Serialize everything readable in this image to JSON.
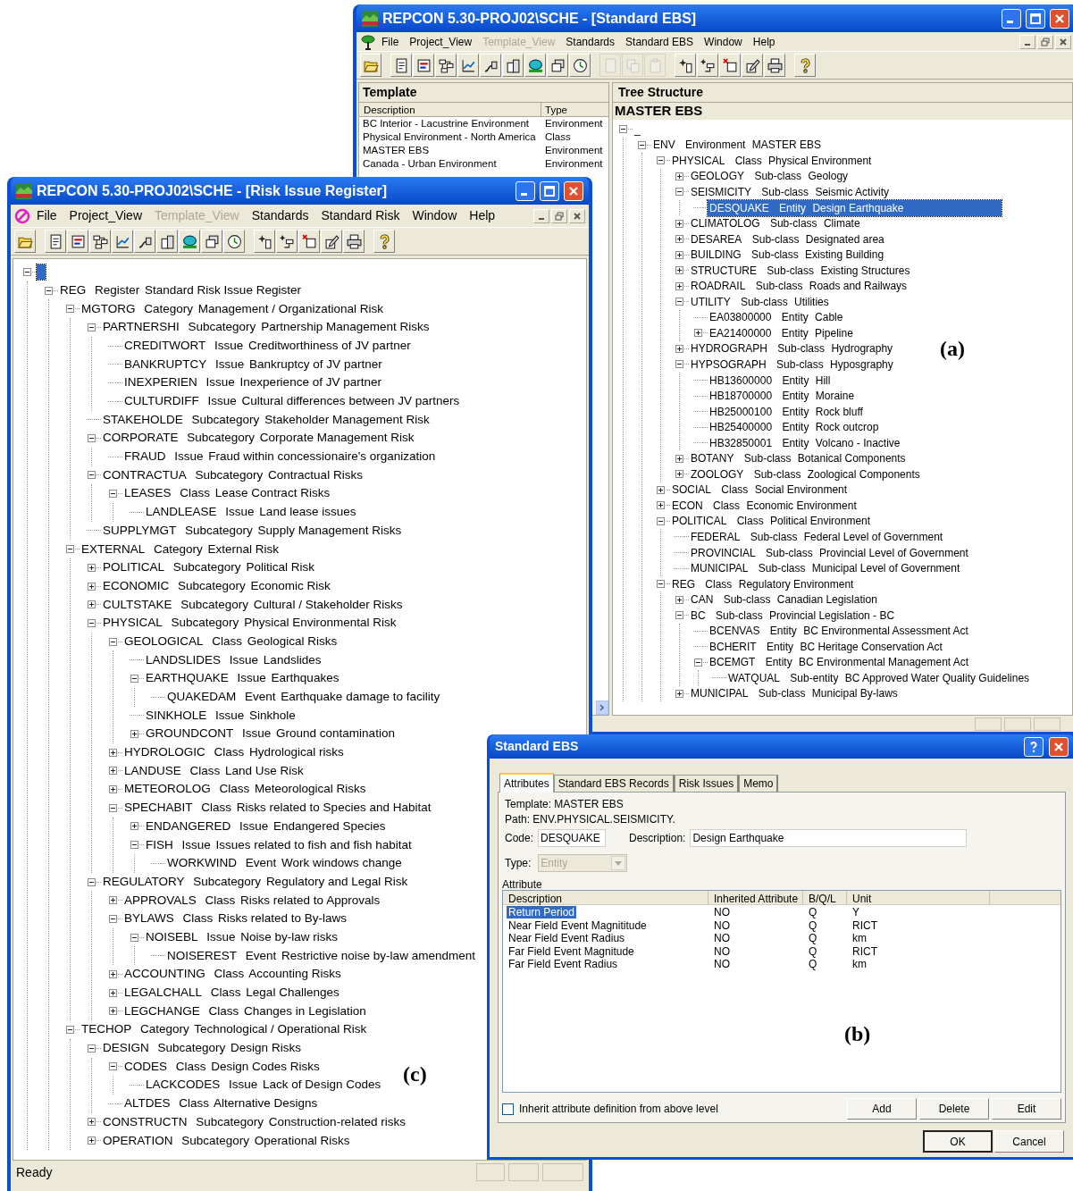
{
  "ebs_window": {
    "title": "REPCON 5.30-PROJ02\\SCHE - [Standard EBS]",
    "menu": [
      {
        "label": "File",
        "disabled": false
      },
      {
        "label": "Project_View",
        "disabled": false
      },
      {
        "label": "Template_View",
        "disabled": true
      },
      {
        "label": "Standards",
        "disabled": false
      },
      {
        "label": "Standard EBS",
        "disabled": false
      },
      {
        "label": "Window",
        "disabled": false
      },
      {
        "label": "Help",
        "disabled": false
      }
    ],
    "toolbar": [
      {
        "disabled": false
      },
      {
        "disabled": false
      },
      {
        "disabled": false
      },
      {
        "disabled": false
      },
      {
        "disabled": false
      },
      {
        "disabled": false
      },
      {
        "disabled": false
      },
      {
        "disabled": false
      },
      {
        "disabled": false
      },
      {
        "disabled": false
      },
      {
        "disabled": true
      },
      {
        "disabled": true
      },
      {
        "disabled": true
      },
      {
        "disabled": false
      },
      {
        "disabled": false
      },
      {
        "disabled": false
      },
      {
        "disabled": false
      },
      {
        "disabled": false
      },
      {
        "disabled": false
      }
    ],
    "template_pane": {
      "title": "Template",
      "columns": [
        "Description",
        "Type"
      ],
      "rows": [
        [
          "BC Interior - Lacustrine Environment",
          "Environment"
        ],
        [
          "Physical Environment - North America",
          "Class"
        ],
        [
          "MASTER EBS",
          "Environment"
        ],
        [
          "Canada - Urban Environment",
          "Environment"
        ]
      ]
    },
    "tree_pane": {
      "title": "Tree Structure",
      "template_name": "MASTER EBS",
      "root": {
        "label": "_",
        "expanded": true,
        "selected": false,
        "children": [
          {
            "code": "ENV",
            "type": "Environment",
            "description": "MASTER EBS",
            "expanded": true,
            "selected": false,
            "children": [
              {
                "code": "PHYSICAL",
                "type": "Class",
                "description": "Physical Environment",
                "expanded": true,
                "selected": false,
                "children": [
                  {
                    "code": "GEOLOGY",
                    "type": "Sub-class",
                    "description": "Geology",
                    "expanded": false,
                    "selected": false
                  },
                  {
                    "code": "SEISMICITY",
                    "type": "Sub-class",
                    "description": "Seismic Activity",
                    "expanded": true,
                    "selected": false,
                    "children": [
                      {
                        "code": "DESQUAKE",
                        "type": "Entity",
                        "description": "Design Earthquake",
                        "selected": true
                      }
                    ]
                  },
                  {
                    "code": "CLIMATOLOG",
                    "type": "Sub-class",
                    "description": "Climate",
                    "expanded": false,
                    "selected": false
                  },
                  {
                    "code": "DESAREA",
                    "type": "Sub-class",
                    "description": "Designated area",
                    "expanded": false,
                    "selected": false
                  },
                  {
                    "code": "BUILDING",
                    "type": "Sub-class",
                    "description": "Existing Building",
                    "expanded": false,
                    "selected": false
                  },
                  {
                    "code": "STRUCTURE",
                    "type": "Sub-class",
                    "description": "Existing Structures",
                    "expanded": false,
                    "selected": false
                  },
                  {
                    "code": "ROADRAIL",
                    "type": "Sub-class",
                    "description": "Roads and Railways",
                    "expanded": false,
                    "selected": false
                  },
                  {
                    "code": "UTILITY",
                    "type": "Sub-class",
                    "description": "Utilities",
                    "expanded": true,
                    "selected": false,
                    "children": [
                      {
                        "code": "EA03800000",
                        "type": "Entity",
                        "description": "Cable",
                        "selected": false
                      },
                      {
                        "code": "EA21400000",
                        "type": "Entity",
                        "description": "Pipeline",
                        "expanded": false,
                        "selected": false
                      }
                    ]
                  },
                  {
                    "code": "HYDROGRAPH",
                    "type": "Sub-class",
                    "description": "Hydrography",
                    "expanded": false,
                    "selected": false
                  },
                  {
                    "code": "HYPSOGRAPH",
                    "type": "Sub-class",
                    "description": "Hyposgraphy",
                    "expanded": true,
                    "selected": false,
                    "children": [
                      {
                        "code": "HB13600000",
                        "type": "Entity",
                        "description": "Hill",
                        "selected": false
                      },
                      {
                        "code": "HB18700000",
                        "type": "Entity",
                        "description": "Moraine",
                        "selected": false
                      },
                      {
                        "code": "HB25000100",
                        "type": "Entity",
                        "description": "Rock bluff",
                        "selected": false
                      },
                      {
                        "code": "HB25400000",
                        "type": "Entity",
                        "description": "Rock outcrop",
                        "selected": false
                      },
                      {
                        "code": "HB32850001",
                        "type": "Entity",
                        "description": "Volcano - Inactive",
                        "selected": false
                      }
                    ]
                  },
                  {
                    "code": "BOTANY",
                    "type": "Sub-class",
                    "description": "Botanical Components",
                    "expanded": false,
                    "selected": false
                  },
                  {
                    "code": "ZOOLOGY",
                    "type": "Sub-class",
                    "description": "Zoological Components",
                    "expanded": false,
                    "selected": false
                  }
                ]
              },
              {
                "code": "SOCIAL",
                "type": "Class",
                "description": "Social Environment",
                "expanded": false,
                "selected": false
              },
              {
                "code": "ECON",
                "type": "Class",
                "description": "Economic Environment",
                "expanded": false,
                "selected": false
              },
              {
                "code": "POLITICAL",
                "type": "Class",
                "description": "Political Environment",
                "expanded": true,
                "selected": false,
                "children": [
                  {
                    "code": "FEDERAL",
                    "type": "Sub-class",
                    "description": "Federal Level of Government",
                    "selected": false
                  },
                  {
                    "code": "PROVINCIAL",
                    "type": "Sub-class",
                    "description": "Provincial Level of Government",
                    "selected": false
                  },
                  {
                    "code": "MUNICIPAL",
                    "type": "Sub-class",
                    "description": "Municipal Level of Government",
                    "selected": false
                  }
                ]
              },
              {
                "code": "REG",
                "type": "Class",
                "description": "Regulatory Environment",
                "expanded": true,
                "selected": false,
                "children": [
                  {
                    "code": "CAN",
                    "type": "Sub-class",
                    "description": "Canadian Legislation",
                    "expanded": false,
                    "selected": false
                  },
                  {
                    "code": "BC",
                    "type": "Sub-class",
                    "description": "Provincial Legislation - BC",
                    "expanded": true,
                    "selected": false,
                    "children": [
                      {
                        "code": "BCENVAS",
                        "type": "Entity",
                        "description": "BC Environmental Assessment Act",
                        "selected": false
                      },
                      {
                        "code": "BCHERIT",
                        "type": "Entity",
                        "description": "BC Heritage Conservation Act",
                        "selected": false
                      },
                      {
                        "code": "BCEMGT",
                        "type": "Entity",
                        "description": "BC Environmental Management Act",
                        "expanded": true,
                        "selected": false,
                        "children": [
                          {
                            "code": "WATQUAL",
                            "type": "Sub-entity",
                            "description": "BC Approved Water Quality Guidelines",
                            "selected": false
                          }
                        ]
                      }
                    ]
                  },
                  {
                    "code": "MUNICIPAL",
                    "type": "Sub-class",
                    "description": "Municipal By-laws",
                    "expanded": false,
                    "selected": false
                  }
                ]
              }
            ]
          }
        ]
      }
    },
    "panel_label": "(a)"
  },
  "risk_window": {
    "title": "REPCON 5.30-PROJ02\\SCHE - [Risk Issue Register]",
    "menu": [
      {
        "label": "File",
        "disabled": false
      },
      {
        "label": "Project_View",
        "disabled": false
      },
      {
        "label": "Template_View",
        "disabled": true
      },
      {
        "label": "Standards",
        "disabled": false
      },
      {
        "label": "Standard Risk",
        "disabled": false
      },
      {
        "label": "Window",
        "disabled": false
      },
      {
        "label": "Help",
        "disabled": false
      }
    ],
    "tree": {
      "expanded": true,
      "selected": true,
      "children": [
        {
          "code": "REG",
          "type": "Register",
          "description": "Standard Risk Issue Register",
          "expanded": true,
          "selected": false,
          "children": [
            {
              "code": "MGTORG",
              "type": "Category",
              "description": "Management / Organizational Risk",
              "expanded": true,
              "selected": false,
              "children": [
                {
                  "code": "PARTNERSHI",
                  "type": "Subcategory",
                  "description": "Partnership Management Risks",
                  "expanded": true,
                  "selected": false,
                  "children": [
                    {
                      "code": "CREDITWORT",
                      "type": "Issue",
                      "description": "Creditworthiness of JV partner",
                      "selected": false
                    },
                    {
                      "code": "BANKRUPTCY",
                      "type": "Issue",
                      "description": "Bankruptcy of JV partner",
                      "selected": false
                    },
                    {
                      "code": "INEXPERIEN",
                      "type": "Issue",
                      "description": "Inexperience of JV partner",
                      "selected": false
                    },
                    {
                      "code": "CULTURDIFF",
                      "type": "Issue",
                      "description": "Cultural differences between JV partners",
                      "selected": false
                    }
                  ]
                },
                {
                  "code": "STAKEHOLDE",
                  "type": "Subcategory",
                  "description": "Stakeholder Management Risk",
                  "selected": false
                },
                {
                  "code": "CORPORATE",
                  "type": "Subcategory",
                  "description": "Corporate Management Risk",
                  "expanded": true,
                  "selected": false,
                  "children": [
                    {
                      "code": "FRAUD",
                      "type": "Issue",
                      "description": "Fraud within concessionaire's organization",
                      "selected": false
                    }
                  ]
                },
                {
                  "code": "CONTRACTUA",
                  "type": "Subcategory",
                  "description": "Contractual Risks",
                  "expanded": true,
                  "selected": false,
                  "children": [
                    {
                      "code": "LEASES",
                      "type": "Class",
                      "description": "Lease Contract Risks",
                      "expanded": true,
                      "selected": false,
                      "children": [
                        {
                          "code": "LANDLEASE",
                          "type": "Issue",
                          "description": "Land lease issues",
                          "selected": false
                        }
                      ]
                    }
                  ]
                },
                {
                  "code": "SUPPLYMGT",
                  "type": "Subcategory",
                  "description": "Supply Management Risks",
                  "selected": false
                }
              ]
            },
            {
              "code": "EXTERNAL",
              "type": "Category",
              "description": "External Risk",
              "expanded": true,
              "selected": false,
              "children": [
                {
                  "code": "POLITICAL",
                  "type": "Subcategory",
                  "description": "Political Risk",
                  "expanded": false,
                  "selected": false
                },
                {
                  "code": "ECONOMIC",
                  "type": "Subcategory",
                  "description": "Economic Risk",
                  "expanded": false,
                  "selected": false
                },
                {
                  "code": "CULTSTAKE",
                  "type": "Subcategory",
                  "description": "Cultural / Stakeholder Risks",
                  "expanded": false,
                  "selected": false
                },
                {
                  "code": "PHYSICAL",
                  "type": "Subcategory",
                  "description": "Physical Environmental Risk",
                  "expanded": true,
                  "selected": false,
                  "children": [
                    {
                      "code": "GEOLOGICAL",
                      "type": "Class",
                      "description": "Geological Risks",
                      "expanded": true,
                      "selected": false,
                      "children": [
                        {
                          "code": "LANDSLIDES",
                          "type": "Issue",
                          "description": "Landslides",
                          "selected": false
                        },
                        {
                          "code": "EARTHQUAKE",
                          "type": "Issue",
                          "description": "Earthquakes",
                          "expanded": true,
                          "selected": false,
                          "children": [
                            {
                              "code": "QUAKEDAM",
                              "type": "Event",
                              "description": "Earthquake damage to facility",
                              "selected": false
                            }
                          ]
                        },
                        {
                          "code": "SINKHOLE",
                          "type": "Issue",
                          "description": "Sinkhole",
                          "selected": false
                        },
                        {
                          "code": "GROUNDCONT",
                          "type": "Issue",
                          "description": "Ground contamination",
                          "expanded": false,
                          "selected": false
                        }
                      ]
                    },
                    {
                      "code": "HYDROLOGIC",
                      "type": "Class",
                      "description": "Hydrological risks",
                      "expanded": false,
                      "selected": false
                    },
                    {
                      "code": "LANDUSE",
                      "type": "Class",
                      "description": "Land Use Risk",
                      "expanded": false,
                      "selected": false
                    },
                    {
                      "code": "METEOROLOG",
                      "type": "Class",
                      "description": "Meteorological Risks",
                      "expanded": false,
                      "selected": false
                    },
                    {
                      "code": "SPECHABIT",
                      "type": "Class",
                      "description": "Risks related to Species and Habitat",
                      "expanded": true,
                      "selected": false,
                      "children": [
                        {
                          "code": "ENDANGERED",
                          "type": "Issue",
                          "description": "Endangered Species",
                          "expanded": false,
                          "selected": false
                        },
                        {
                          "code": "FISH",
                          "type": "Issue",
                          "description": "Issues related to fish and fish habitat",
                          "expanded": true,
                          "selected": false,
                          "children": [
                            {
                              "code": "WORKWIND",
                              "type": "Event",
                              "description": "Work windows change",
                              "selected": false
                            }
                          ]
                        }
                      ]
                    }
                  ]
                },
                {
                  "code": "REGULATORY",
                  "type": "Subcategory",
                  "description": "Regulatory and Legal Risk",
                  "expanded": true,
                  "selected": false,
                  "children": [
                    {
                      "code": "APPROVALS",
                      "type": "Class",
                      "description": "Risks related to Approvals",
                      "expanded": false,
                      "selected": false
                    },
                    {
                      "code": "BYLAWS",
                      "type": "Class",
                      "description": "Risks related to By-laws",
                      "expanded": true,
                      "selected": false,
                      "children": [
                        {
                          "code": "NOISEBL",
                          "type": "Issue",
                          "description": "Noise by-law risks",
                          "expanded": true,
                          "selected": false,
                          "children": [
                            {
                              "code": "NOISEREST",
                              "type": "Event",
                              "description": "Restrictive noise by-law amendment",
                              "selected": false
                            }
                          ]
                        }
                      ]
                    },
                    {
                      "code": "ACCOUNTING",
                      "type": "Class",
                      "description": "Accounting Risks",
                      "expanded": false,
                      "selected": false
                    },
                    {
                      "code": "LEGALCHALL",
                      "type": "Class",
                      "description": "Legal Challenges",
                      "expanded": false,
                      "selected": false
                    },
                    {
                      "code": "LEGCHANGE",
                      "type": "Class",
                      "description": "Changes in Legislation",
                      "expanded": false,
                      "selected": false
                    }
                  ]
                }
              ]
            },
            {
              "code": "TECHOP",
              "type": "Category",
              "description": "Technological / Operational Risk",
              "expanded": true,
              "selected": false,
              "children": [
                {
                  "code": "DESIGN",
                  "type": "Subcategory",
                  "description": "Design Risks",
                  "expanded": true,
                  "selected": false,
                  "children": [
                    {
                      "code": "CODES",
                      "type": "Class",
                      "description": "Design Codes Risks",
                      "expanded": true,
                      "selected": false,
                      "children": [
                        {
                          "code": "LACKCODES",
                          "type": "Issue",
                          "description": "Lack of Design Codes",
                          "selected": false
                        }
                      ]
                    },
                    {
                      "code": "ALTDES",
                      "type": "Class",
                      "description": "Alternative Designs",
                      "selected": false
                    }
                  ]
                },
                {
                  "code": "CONSTRUCTN",
                  "type": "Subcategory",
                  "description": "Construction-related risks",
                  "expanded": false,
                  "selected": false
                },
                {
                  "code": "OPERATION",
                  "type": "Subcategory",
                  "description": "Operational Risks",
                  "expanded": false,
                  "selected": false
                }
              ]
            }
          ]
        }
      ]
    },
    "status": "Ready",
    "panel_label": "(c)"
  },
  "dialog": {
    "title": "Standard EBS",
    "tabs": [
      {
        "label": "Attributes",
        "selected": true
      },
      {
        "label": "Standard EBS Records",
        "selected": false
      },
      {
        "label": "Risk Issues",
        "selected": false
      },
      {
        "label": "Memo",
        "selected": false
      }
    ],
    "template_line": "Template: MASTER EBS",
    "path_line": "Path: ENV.PHYSICAL.SEISMICITY.",
    "code": {
      "label": "Code:",
      "value": "DESQUAKE"
    },
    "description": {
      "label": "Description:",
      "value": "Design Earthquake"
    },
    "type": {
      "label": "Type:",
      "value": "Entity",
      "disabled": true
    },
    "attribute_group": "Attribute",
    "table": {
      "columns": [
        "Description",
        "Inherited Attribute",
        "B/Q/L",
        "Unit"
      ],
      "rows": [
        {
          "cells": [
            "Return Period",
            "NO",
            "Q",
            "Y"
          ],
          "selected": true
        },
        {
          "cells": [
            "Near Field Event Magnititude",
            "NO",
            "Q",
            "RICT"
          ],
          "selected": false
        },
        {
          "cells": [
            "Near Field Event Radius",
            "NO",
            "Q",
            "km"
          ],
          "selected": false
        },
        {
          "cells": [
            "Far Field Event Magnitude",
            "NO",
            "Q",
            "RICT"
          ],
          "selected": false
        },
        {
          "cells": [
            "Far Field Event Radius",
            "NO",
            "Q",
            "km"
          ],
          "selected": false
        }
      ]
    },
    "inherit_checkbox": {
      "label": "Inherit attribute definition from above level",
      "checked": false
    },
    "row_buttons": [
      "Add",
      "Delete",
      "Edit"
    ],
    "footer_buttons": [
      {
        "label": "OK",
        "default": true
      },
      {
        "label": "Cancel",
        "default": false
      }
    ],
    "panel_label": "(b)"
  }
}
